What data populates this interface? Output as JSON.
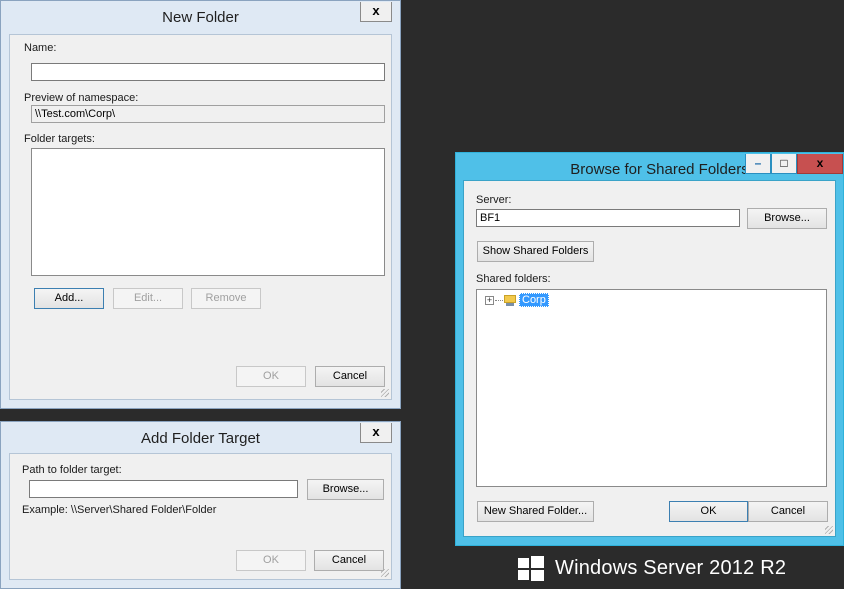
{
  "new_folder": {
    "title": "New Folder",
    "close": "x",
    "name_label": "Name:",
    "name_value": "",
    "preview_label": "Preview of namespace:",
    "preview_value": "\\\\Test.com\\Corp\\",
    "targets_label": "Folder targets:",
    "add": "Add...",
    "edit": "Edit...",
    "remove": "Remove",
    "ok": "OK",
    "cancel": "Cancel"
  },
  "add_target": {
    "title": "Add Folder Target",
    "close": "x",
    "path_label": "Path to folder target:",
    "path_value": "",
    "browse": "Browse...",
    "example": "Example: \\\\Server\\Shared Folder\\Folder",
    "ok": "OK",
    "cancel": "Cancel"
  },
  "browse": {
    "title": "Browse for Shared Folders",
    "minimize": "–",
    "maximize": "□",
    "close": "x",
    "server_label": "Server:",
    "server_value": "BF1",
    "browse": "Browse...",
    "show_shared": "Show Shared Folders",
    "shared_label": "Shared folders:",
    "tree": [
      {
        "label": "Corp",
        "expander": "+",
        "selected": true
      }
    ],
    "new_shared": "New Shared Folder...",
    "ok": "OK",
    "cancel": "Cancel"
  },
  "branding": {
    "text": "Windows Server 2012 R2"
  },
  "colors": {
    "active_caption": "#4fc0e8",
    "inactive_caption": "#dfe9f4",
    "selection": "#3399ff"
  }
}
